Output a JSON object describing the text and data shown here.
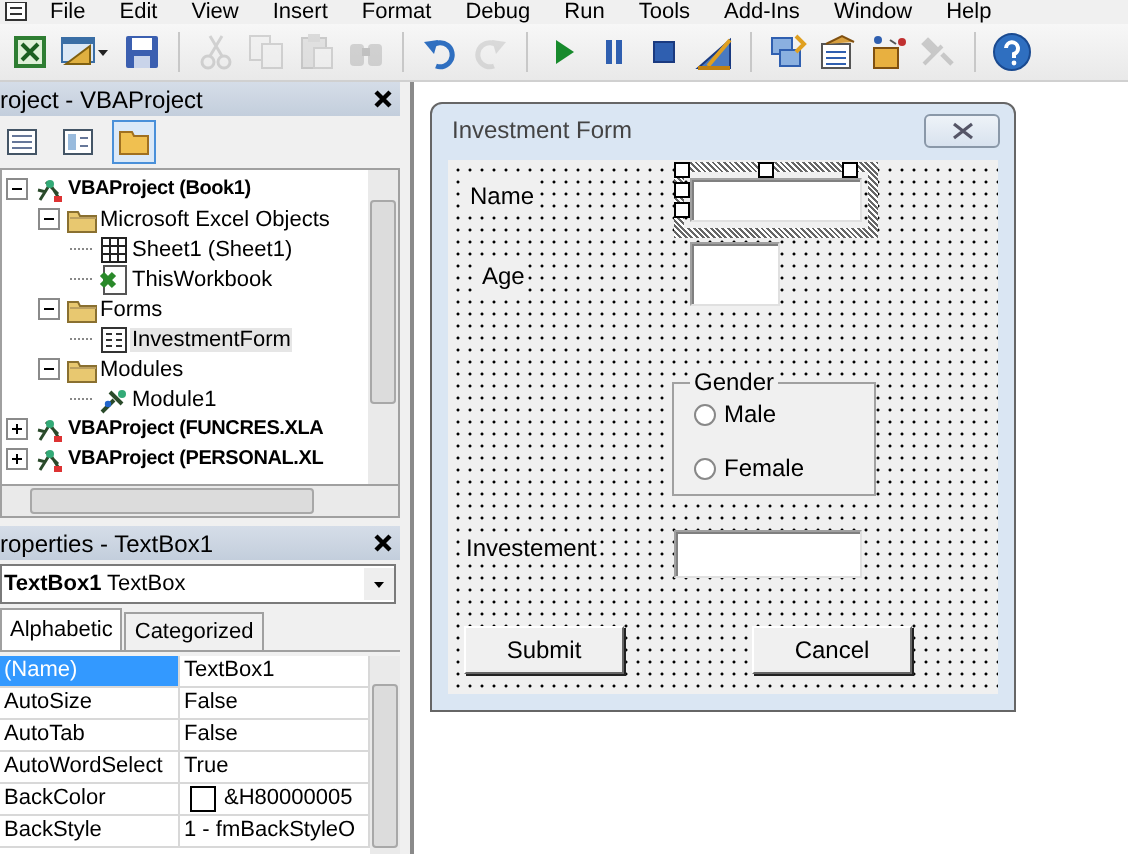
{
  "menu": [
    "File",
    "Edit",
    "View",
    "Insert",
    "Format",
    "Debug",
    "Run",
    "Tools",
    "Add-Ins",
    "Window",
    "Help"
  ],
  "toolbar": [
    {
      "kind": "excel",
      "disabled": false
    },
    {
      "kind": "userform",
      "disabled": false
    },
    {
      "kind": "save",
      "disabled": false
    },
    {
      "kind": "separator"
    },
    {
      "kind": "cut",
      "disabled": true
    },
    {
      "kind": "copy",
      "disabled": true
    },
    {
      "kind": "paste",
      "disabled": true
    },
    {
      "kind": "find",
      "disabled": true
    },
    {
      "kind": "separator"
    },
    {
      "kind": "undo",
      "disabled": false
    },
    {
      "kind": "redo",
      "disabled": true
    },
    {
      "kind": "separator"
    },
    {
      "kind": "run",
      "disabled": false
    },
    {
      "kind": "pause",
      "disabled": false
    },
    {
      "kind": "stop",
      "disabled": false
    },
    {
      "kind": "design",
      "disabled": false
    },
    {
      "kind": "separator"
    },
    {
      "kind": "project",
      "disabled": false
    },
    {
      "kind": "properties",
      "disabled": false
    },
    {
      "kind": "browser",
      "disabled": false
    },
    {
      "kind": "toolbox",
      "disabled": true
    },
    {
      "kind": "separator"
    },
    {
      "kind": "help",
      "disabled": false
    }
  ],
  "project": {
    "title": "roject - VBAProject",
    "buttons": [
      {
        "kind": "code",
        "selected": false
      },
      {
        "kind": "object",
        "selected": false
      },
      {
        "kind": "folders",
        "selected": true
      }
    ],
    "tree": [
      {
        "label": "VBAProject (Book1)",
        "kind": "project",
        "expanded": true,
        "selected": false,
        "children": [
          {
            "label": "Microsoft Excel Objects",
            "kind": "folder",
            "expanded": true,
            "selected": false,
            "children": [
              {
                "label": "Sheet1 (Sheet1)",
                "kind": "sheet",
                "selected": false
              },
              {
                "label": "ThisWorkbook",
                "kind": "workbook",
                "selected": false
              }
            ]
          },
          {
            "label": "Forms",
            "kind": "folder",
            "expanded": true,
            "selected": false,
            "children": [
              {
                "label": "InvestmentForm",
                "kind": "form",
                "selected": true
              }
            ]
          },
          {
            "label": "Modules",
            "kind": "folder",
            "expanded": true,
            "selected": false,
            "children": [
              {
                "label": "Module1",
                "kind": "module",
                "selected": false
              }
            ]
          }
        ]
      },
      {
        "label": "VBAProject (FUNCRES.XLA",
        "kind": "project",
        "expanded": false,
        "selected": false
      },
      {
        "label": "VBAProject (PERSONAL.XL",
        "kind": "project",
        "expanded": false,
        "selected": false
      }
    ]
  },
  "properties": {
    "title": "roperties - TextBox1",
    "object": "**TextBox1** TextBox",
    "tabs": [
      {
        "label": "Alphabetic",
        "selected": true
      },
      {
        "label": "Categorized",
        "selected": false
      }
    ],
    "rows": [
      {
        "name": "(Name)",
        "value": "TextBox1",
        "kind": "text",
        "selected": true
      },
      {
        "name": "AutoSize",
        "value": "False",
        "kind": "text",
        "selected": false
      },
      {
        "name": "AutoTab",
        "value": "False",
        "kind": "text",
        "selected": false
      },
      {
        "name": "AutoWordSelect",
        "value": "True",
        "kind": "text",
        "selected": false
      },
      {
        "name": "BackColor",
        "value": "&H80000005",
        "kind": "color",
        "color": "#ffffff",
        "selected": false
      },
      {
        "name": "BackStyle",
        "value": "1 - fmBackStyleO",
        "kind": "text",
        "selected": false
      }
    ]
  },
  "form": {
    "title": "Investment Form",
    "controls": [
      {
        "kind": "label",
        "text": "Name"
      },
      {
        "kind": "textbox",
        "selected": true
      },
      {
        "kind": "label",
        "text": "Age"
      },
      {
        "kind": "textbox",
        "selected": false
      },
      {
        "kind": "frame",
        "caption": "Gender",
        "options": [
          {
            "label": "Male",
            "checked": false
          },
          {
            "label": "Female",
            "checked": false
          }
        ]
      },
      {
        "kind": "label",
        "text": "Investement"
      },
      {
        "kind": "textbox",
        "selected": false
      },
      {
        "kind": "button",
        "text": "Submit"
      },
      {
        "kind": "button",
        "text": "Cancel"
      }
    ]
  }
}
